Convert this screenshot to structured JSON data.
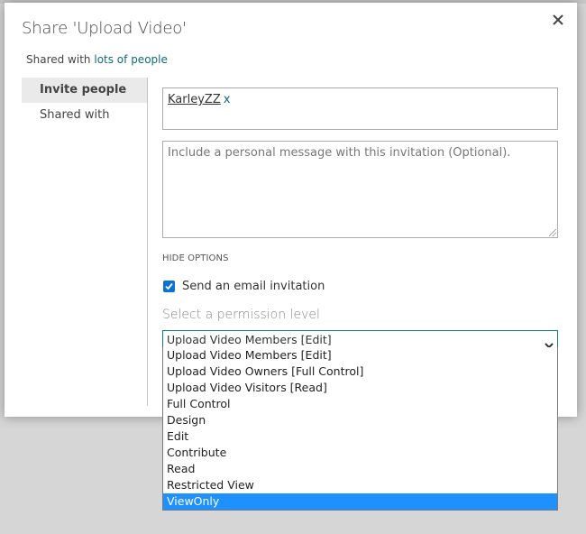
{
  "dialog": {
    "title": "Share 'Upload Video'",
    "close_icon": "close-icon",
    "shared_with_prefix": "Shared with",
    "shared_with_link": "lots of people"
  },
  "sidenav": {
    "items": [
      {
        "label": "Invite people",
        "active": true
      },
      {
        "label": "Shared with",
        "active": false
      }
    ]
  },
  "invite": {
    "people": [
      {
        "name": "KarleyZZ",
        "remove": "x"
      }
    ],
    "message_placeholder": "Include a personal message with this invitation (Optional).",
    "message_value": "",
    "hide_options_label": "HIDE OPTIONS",
    "send_email": {
      "label": "Send an email invitation",
      "checked": true
    },
    "permission_label": "Select a permission level",
    "permission_selected": "Upload Video Members [Edit]",
    "permission_options": [
      "Upload Video Members [Edit]",
      "Upload Video Owners [Full Control]",
      "Upload Video Visitors [Read]",
      "Full Control",
      "Design",
      "Edit",
      "Contribute",
      "Read",
      "Restricted View",
      "ViewOnly"
    ],
    "highlighted_option": "ViewOnly"
  },
  "colors": {
    "accent_link": "#0f6a7a",
    "checkbox": "#0a72d5",
    "select_border": "#127b7b",
    "highlight": "#1e90ff"
  }
}
